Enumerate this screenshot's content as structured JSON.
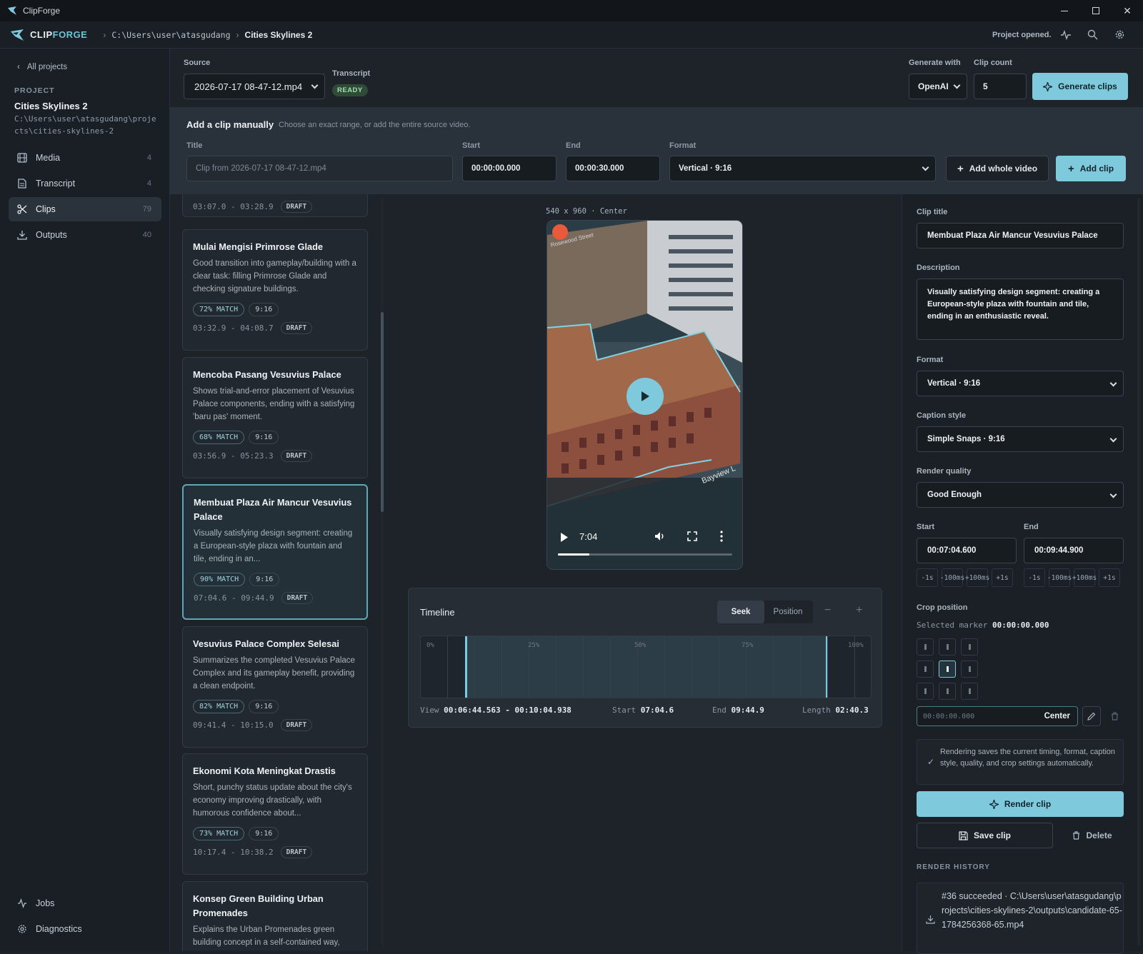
{
  "window": {
    "title": "ClipForge"
  },
  "appbar": {
    "brand_a": "CLIP",
    "brand_b": "FORGE",
    "crumb_path": "C:\\Users\\user\\atasgudang",
    "crumb_project": "Cities Skylines 2",
    "status": "Project opened."
  },
  "sidebar": {
    "back": "All projects",
    "project_label": "PROJECT",
    "project_name": "Cities Skylines 2",
    "project_path": "C:\\Users\\user\\atasgudang\\projects\\cities-skylines-2",
    "items": [
      {
        "label": "Media",
        "count": "4"
      },
      {
        "label": "Transcript",
        "count": "4"
      },
      {
        "label": "Clips",
        "count": "79"
      },
      {
        "label": "Outputs",
        "count": "40"
      }
    ],
    "jobs": "Jobs",
    "diagnostics": "Diagnostics"
  },
  "source": {
    "label": "Source",
    "file": "2026-07-17 08-47-12.mp4",
    "transcript_label": "Transcript",
    "transcript_status": "READY",
    "generate_label": "Generate with",
    "provider": "OpenAI",
    "count_label": "Clip count",
    "count": "5",
    "generate_button": "Generate clips"
  },
  "manual": {
    "heading": "Add a clip manually",
    "hint": "Choose an exact range, or add the entire source video.",
    "title_label": "Title",
    "title_placeholder": "Clip from 2026-07-17 08-47-12.mp4",
    "start_label": "Start",
    "start": "00:00:00.000",
    "end_label": "End",
    "end": "00:00:30.000",
    "format_label": "Format",
    "format": "Vertical · 9:16",
    "add_whole": "Add whole video",
    "add_clip": "Add clip"
  },
  "clips": [
    {
      "time": "03:07.0 - 03:28.9",
      "status": "DRAFT"
    },
    {
      "title": "Mulai Mengisi Primrose Glade",
      "desc": "Good transition into gameplay/building with a clear task: filling Primrose Glade and checking signature buildings.",
      "match": "72% MATCH",
      "ratio": "9:16",
      "time": "03:32.9 - 04:08.7",
      "status": "DRAFT"
    },
    {
      "title": "Mencoba Pasang Vesuvius Palace",
      "desc": "Shows trial-and-error placement of Vesuvius Palace components, ending with a satisfying 'baru pas' moment.",
      "match": "68% MATCH",
      "ratio": "9:16",
      "time": "03:56.9 - 05:23.3",
      "status": "DRAFT"
    },
    {
      "title": "Membuat Plaza Air Mancur Vesuvius Palace",
      "desc": "Visually satisfying design segment: creating a European-style plaza with fountain and tile, ending in an...",
      "match": "90% MATCH",
      "ratio": "9:16",
      "time": "07:04.6 - 09:44.9",
      "status": "DRAFT"
    },
    {
      "title": "Vesuvius Palace Complex Selesai",
      "desc": "Summarizes the completed Vesuvius Palace Complex and its gameplay benefit, providing a clean endpoint.",
      "match": "82% MATCH",
      "ratio": "9:16",
      "time": "09:41.4 - 10:15.0",
      "status": "DRAFT"
    },
    {
      "title": "Ekonomi Kota Meningkat Drastis",
      "desc": "Short, punchy status update about the city's economy improving drastically, with humorous confidence about...",
      "match": "73% MATCH",
      "ratio": "9:16",
      "time": "10:17.4 - 10:38.2",
      "status": "DRAFT"
    },
    {
      "title": "Konsep Green Building Urban Promenades",
      "desc": "Explains the Urban Promenades green building concept in a self-contained way,"
    }
  ],
  "preview": {
    "caption": "540 x 960 · Center",
    "time": "7:04",
    "progress": 0.18,
    "street": "Rosewood Street",
    "street2": "Bayview L"
  },
  "timeline": {
    "title": "Timeline",
    "seek": "Seek",
    "position": "Position",
    "ticks": [
      "0%",
      "25%",
      "50%",
      "75%",
      "100%"
    ],
    "view_label": "View",
    "view": "00:06:44.563 - 00:10:04.938",
    "start_label": "Start",
    "start": "07:04.6",
    "end_label": "End",
    "end": "09:44.9",
    "length_label": "Length",
    "length": "02:40.3"
  },
  "details": {
    "title_label": "Clip title",
    "title": "Membuat Plaza Air Mancur Vesuvius Palace",
    "desc_label": "Description",
    "desc": "Visually satisfying design segment: creating a European-style plaza with fountain and tile, ending in an enthusiastic reveal.",
    "format_label": "Format",
    "format": "Vertical · 9:16",
    "caption_label": "Caption style",
    "caption": "Simple Snaps · 9:16",
    "quality_label": "Render quality",
    "quality": "Good Enough",
    "start_label": "Start",
    "start": "00:07:04.600",
    "end_label": "End",
    "end": "00:09:44.900",
    "steps": [
      "-1s",
      "-100ms",
      "+100ms",
      "+1s"
    ],
    "crop_label": "Crop position",
    "marker_label": "Selected marker",
    "marker": "00:00:00.000",
    "marker_input": "00:00:00.000",
    "center": "Center",
    "note": "Rendering saves the current timing, format, caption style, quality, and crop settings automatically.",
    "render": "Render clip",
    "save": "Save clip",
    "delete": "Delete",
    "history_label": "RENDER HISTORY",
    "history": "#36 succeeded · C:\\Users\\user\\atasgudang\\projects\\cities-skylines-2\\outputs\\candidate-65-1784256368-65.mp4"
  },
  "colors": {
    "accent": "#7ec9dc",
    "bg": "#1e2329"
  }
}
